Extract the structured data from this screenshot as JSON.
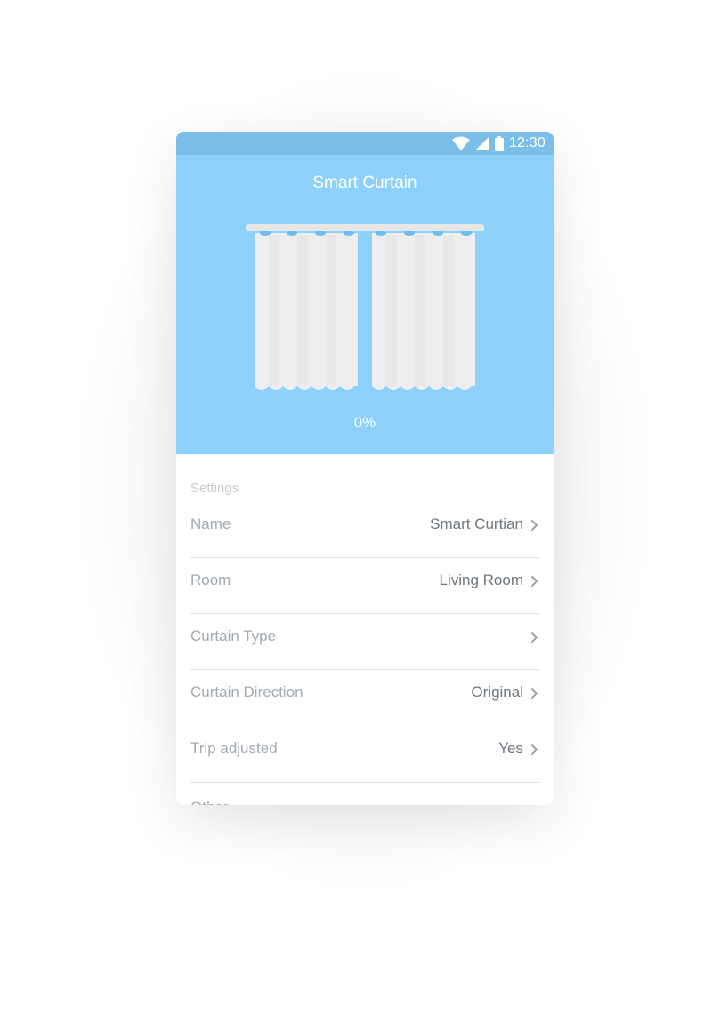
{
  "status_bar": {
    "time": "12:30",
    "icons": [
      "wifi-icon",
      "cellular-signal-icon",
      "battery-icon"
    ]
  },
  "header": {
    "title": "Smart Curtain"
  },
  "curtain": {
    "open_percent_label": "0%",
    "open_fraction": 0
  },
  "settings": {
    "section_title": "Settings",
    "rows": [
      {
        "label": "Name",
        "value": "Smart Curtian"
      },
      {
        "label": "Room",
        "value": "Living Room"
      },
      {
        "label": "Curtain Type",
        "value": ""
      },
      {
        "label": "Curtain Direction",
        "value": "Original"
      },
      {
        "label": "Trip adjusted",
        "value": "Yes"
      }
    ],
    "partial_next_label": "Other"
  },
  "colors": {
    "status_bar": "#7bbfe8",
    "hero_background": "#8dd1fb",
    "curtain_fabric": "#eeeeee",
    "divider": "#dfe3e6",
    "chevron": "#9aa3ad"
  }
}
